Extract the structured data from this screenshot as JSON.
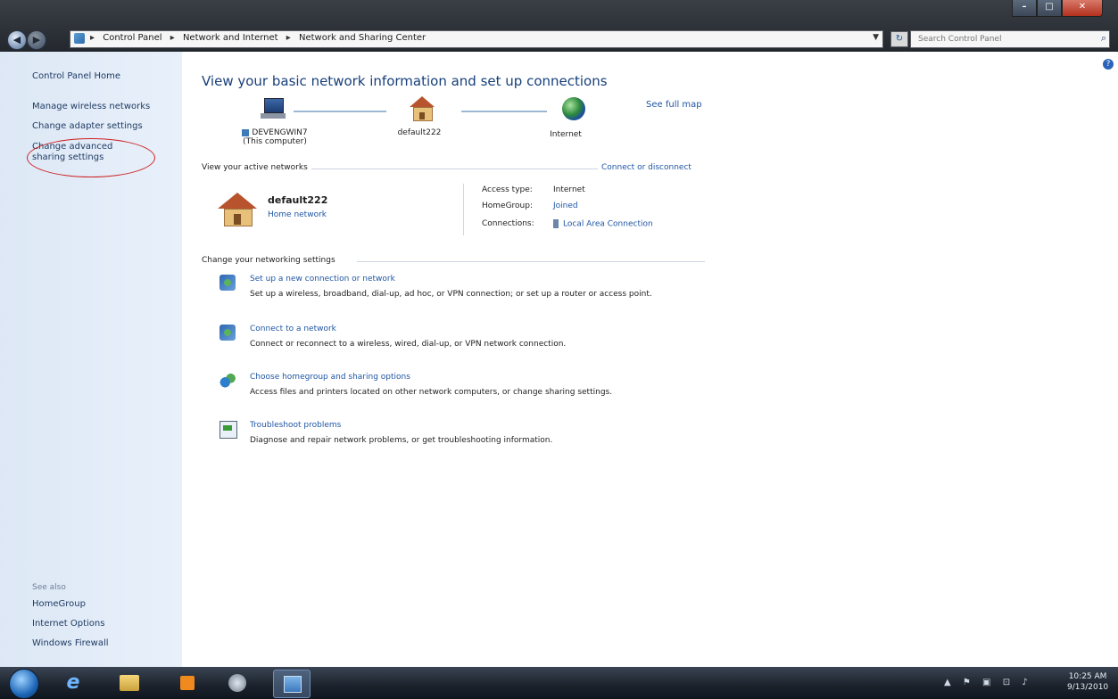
{
  "window": {
    "breadcrumbs": [
      "Control Panel",
      "Network and Internet",
      "Network and Sharing Center"
    ],
    "search_placeholder": "Search Control Panel",
    "help_label": "?"
  },
  "sidebar": {
    "home": "Control Panel Home",
    "links": [
      {
        "label": "Manage wireless networks"
      },
      {
        "label": "Change adapter settings"
      },
      {
        "label": "Change advanced sharing settings"
      }
    ],
    "see_also_title": "See also",
    "see_also": [
      {
        "label": "HomeGroup"
      },
      {
        "label": "Internet Options"
      },
      {
        "label": "Windows Firewall"
      }
    ]
  },
  "main": {
    "heading": "View your basic network information and set up connections",
    "see_full_map": "See full map",
    "map": {
      "computer_name": "DEVENGWIN7",
      "computer_sub": "(This computer)",
      "network_name": "default222",
      "internet_label": "Internet"
    },
    "active_networks": {
      "title": "View your active networks",
      "connect_link": "Connect or disconnect",
      "network_name": "default222",
      "network_type": "Home network",
      "access_type_label": "Access type:",
      "access_type_value": "Internet",
      "homegroup_label": "HomeGroup:",
      "homegroup_value": "Joined",
      "connections_label": "Connections:",
      "connections_value": "Local Area Connection"
    },
    "change_settings": {
      "title": "Change your networking settings",
      "tasks": [
        {
          "link": "Set up a new connection or network",
          "desc": "Set up a wireless, broadband, dial-up, ad hoc, or VPN connection; or set up a router or access point."
        },
        {
          "link": "Connect to a network",
          "desc": "Connect or reconnect to a wireless, wired, dial-up, or VPN network connection."
        },
        {
          "link": "Choose homegroup and sharing options",
          "desc": "Access files and printers located on other network computers, or change sharing settings."
        },
        {
          "link": "Troubleshoot problems",
          "desc": "Diagnose and repair network problems, or get troubleshooting information."
        }
      ]
    }
  },
  "taskbar": {
    "time": "10:25 AM",
    "date": "9/13/2010"
  },
  "colors": {
    "link": "#1f56a3",
    "heading": "#173f7a",
    "sidebar_bg": "#dde8f6",
    "highlight_circle": "#cc1f1f"
  }
}
